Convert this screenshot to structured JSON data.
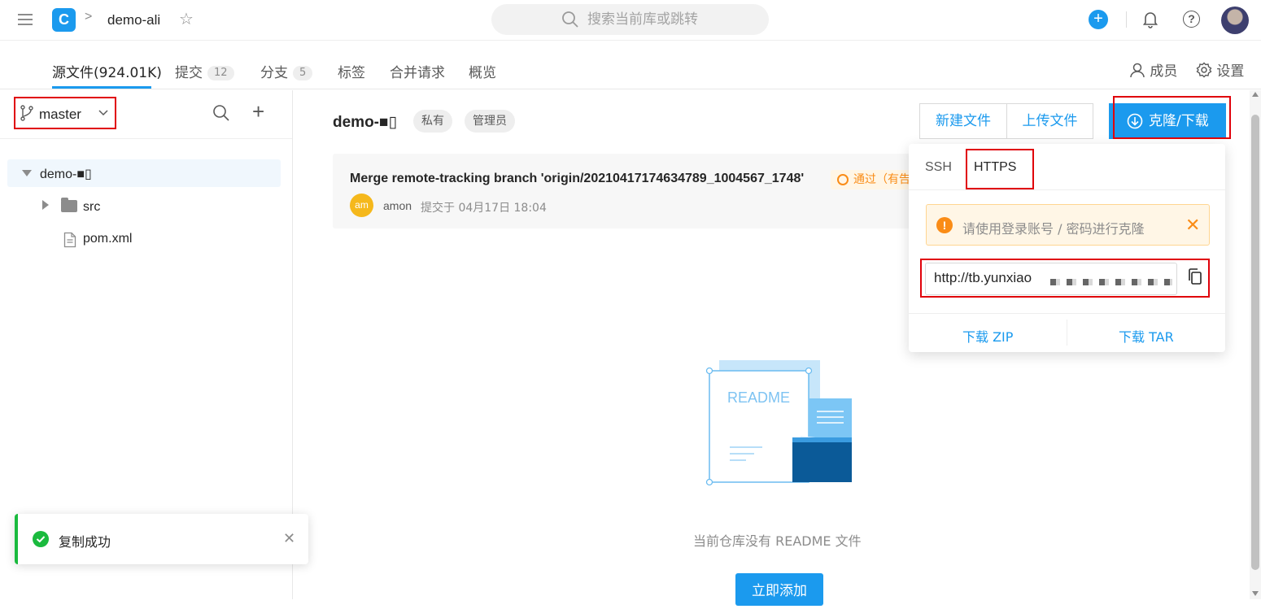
{
  "header": {
    "repo_name": "demo-ali",
    "search_placeholder": "搜索当前库或跳转"
  },
  "tabs": [
    {
      "label": "源文件(924.01K)"
    },
    {
      "label": "提交",
      "badge": "12"
    },
    {
      "label": "分支",
      "badge": "5"
    },
    {
      "label": "标签"
    },
    {
      "label": "合并请求"
    },
    {
      "label": "概览"
    }
  ],
  "tabs_right": {
    "members": "成员",
    "settings": "设置"
  },
  "sidebar": {
    "branch": "master",
    "tree": {
      "root": "demo-■▯",
      "folder": "src",
      "file": "pom.xml"
    }
  },
  "toast": {
    "message": "复制成功"
  },
  "main": {
    "repo_title": "demo-■▯",
    "tags": [
      "私有",
      "管理员"
    ],
    "new_file": "新建文件",
    "upload_file": "上传文件",
    "clone_download": "克隆/下载",
    "commit": {
      "title": "Merge remote-tracking branch 'origin/20210417174634789_1004567_1748'",
      "status": "通过（有告警）",
      "avatar_initials": "am",
      "author": "amon",
      "time": "提交于 04月17日 18:04"
    },
    "empty_text": "当前仓库没有 README 文件",
    "readme_label": "README",
    "add_button": "立即添加"
  },
  "clone_popup": {
    "tabs": [
      "SSH",
      "HTTPS"
    ],
    "alert": "请使用登录账号 / 密码进行克隆",
    "url": "http://tb.yunxiao",
    "download_zip": "下载 ZIP",
    "download_tar": "下载 TAR"
  },
  "colors": {
    "accent": "#1b9aee",
    "highlight": "#e0000a",
    "success": "#1aba3e",
    "warning": "#fa8c16"
  }
}
